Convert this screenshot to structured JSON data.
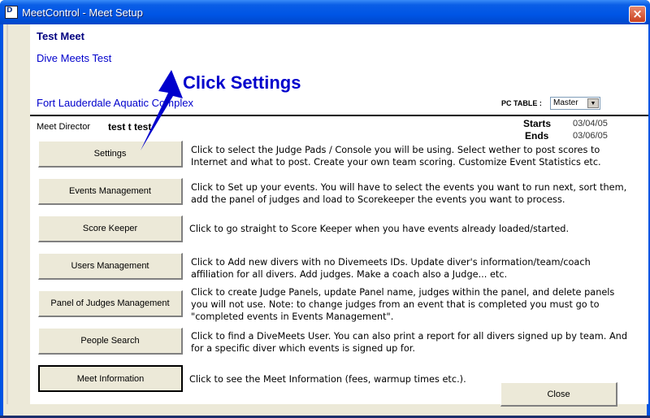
{
  "window": {
    "title": "MeetControl - Meet Setup",
    "close_glyph": "×",
    "app_icon": "divemeets-app-icon",
    "app_icon_glyph": "D"
  },
  "meet": {
    "name": "Test Meet",
    "subtitle": "Dive Meets Test",
    "venue": "Fort Lauderdale Aquatic Complex",
    "director_label": "Meet Director",
    "director_value": "test t test",
    "starts_label": "Starts",
    "starts_value": "03/04/05",
    "ends_label": "Ends",
    "ends_value": "03/06/05"
  },
  "pc_table": {
    "label": "PC TABLE :",
    "selected": "Master",
    "arrow_glyph": "▼"
  },
  "callout": {
    "text": "Click Settings",
    "color": "#0000cc"
  },
  "menu": [
    {
      "label": "Settings",
      "description": "Click to select the Judge Pads / Console you will be using. Select wether to post scores to Internet and what to post. Create your own team scoring. Customize Event Statistics etc."
    },
    {
      "label": "Events Management",
      "description": "Click to Set up your events. You will have to select the events you want to run next, sort them, add the panel of judges and load to Scorekeeper the events you want to process."
    },
    {
      "label": "Score Keeper",
      "description": "Click to go straight to Score Keeper when you have events already loaded/started."
    },
    {
      "label": "Users Management",
      "description": "Click to Add new divers with no Divemeets IDs. Update diver's information/team/coach affiliation for all divers. Add judges. Make a coach also a Judge... etc."
    },
    {
      "label": "Panel of Judges Management",
      "description": "Click to create Judge Panels, update Panel name, judges within the panel, and delete panels you will not use. Note: to change judges from an event that is completed you must go to \"completed events in Events Management\"."
    },
    {
      "label": "People Search",
      "description": "Click to find a DiveMeets User. You can also print a report for all divers signed up by team. And for a specific diver which events is signed up for."
    },
    {
      "label": "Meet Information",
      "description": "Click to see the Meet Information (fees, warmup times etc.)."
    }
  ],
  "close_button": {
    "label": "Close"
  },
  "colors": {
    "titlebar": "#0055e5",
    "accent_text": "#0000cc",
    "face": "#ece9d8"
  }
}
